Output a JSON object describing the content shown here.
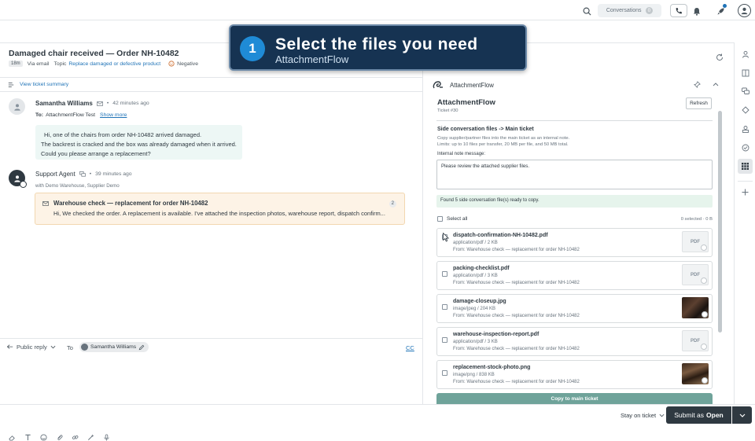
{
  "topbar": {
    "conversations_label": "Conversations",
    "conversations_count": "0"
  },
  "ticket": {
    "title": "Damaged chair received — Order NH-10482",
    "age": "18m",
    "channel": "Via email",
    "topic_label": "Topic",
    "topic_value": "Replace damaged or defective product",
    "sentiment": "Negative",
    "summary_link": "View ticket summary"
  },
  "messages": [
    {
      "author": "Samantha Williams",
      "time": "42 minutes ago",
      "to_label": "To:",
      "to_value": "AttachmentFlow Test",
      "show_more": "Show more",
      "lines": [
        "Hi, one of the chairs from order NH-10482 arrived damaged.",
        "The backrest is cracked and the box was already damaged when it arrived.",
        "Could you please arrange a replacement?"
      ]
    },
    {
      "author": "Support Agent",
      "time": "39 minutes ago",
      "with_line": "with Demo Warehouse, Supplier Demo",
      "side_title": "Warehouse check — replacement for order NH-10482",
      "side_preview": "Hi, We checked the order. A replacement is available. I've attached the inspection photos, warehouse report, dispatch confirm...",
      "side_count": "2"
    }
  ],
  "compose": {
    "mode": "Public reply",
    "to_label": "To",
    "recipient": "Samantha Williams",
    "cc": "CC"
  },
  "app": {
    "header_name": "AttachmentFlow",
    "title": "AttachmentFlow",
    "ticket_ref": "Ticket #30",
    "refresh": "Refresh",
    "section_title": "Side conversation files -> Main ticket",
    "desc1": "Copy supplier/partner files into the main ticket as an internal note.",
    "desc2": "Limits: up to 10 files per transfer, 20 MB per file, and 50 MB total.",
    "note_label": "Internal note message:",
    "note_value": "Please review the attached supplier files.",
    "found_banner": "Found 5 side conversation file(s) ready to copy.",
    "select_all": "Select all",
    "selected_summary": "0 selected · 0 B",
    "copy_button": "Copy to main ticket",
    "files": [
      {
        "name": "dispatch-confirmation-NH-10482.pdf",
        "meta": "application/pdf / 2 KB",
        "from": "From: Warehouse check — replacement for order NH-10482",
        "thumb": "PDF"
      },
      {
        "name": "packing-checklist.pdf",
        "meta": "application/pdf / 3 KB",
        "from": "From: Warehouse check — replacement for order NH-10482",
        "thumb": "PDF"
      },
      {
        "name": "damage-closeup.jpg",
        "meta": "image/jpeg / 204 KB",
        "from": "From: Warehouse check — replacement for order NH-10482",
        "thumb": ""
      },
      {
        "name": "warehouse-inspection-report.pdf",
        "meta": "application/pdf / 3 KB",
        "from": "From: Warehouse check — replacement for order NH-10482",
        "thumb": "PDF"
      },
      {
        "name": "replacement-stock-photo.png",
        "meta": "image/png / 838 KB",
        "from": "From: Warehouse check — replacement for order NH-10482",
        "thumb": ""
      }
    ]
  },
  "bottombar": {
    "stay": "Stay on ticket",
    "submit_prefix": "Submit as",
    "submit_status": "Open"
  },
  "overlay": {
    "step": "1",
    "title": "Select the files you need",
    "subtitle": "AttachmentFlow"
  },
  "colors": {
    "accent_blue": "#1f73b7",
    "banner_green": "#e6f4ec",
    "copy_button": "#6fa39a",
    "overlay_bg": "#163352"
  }
}
